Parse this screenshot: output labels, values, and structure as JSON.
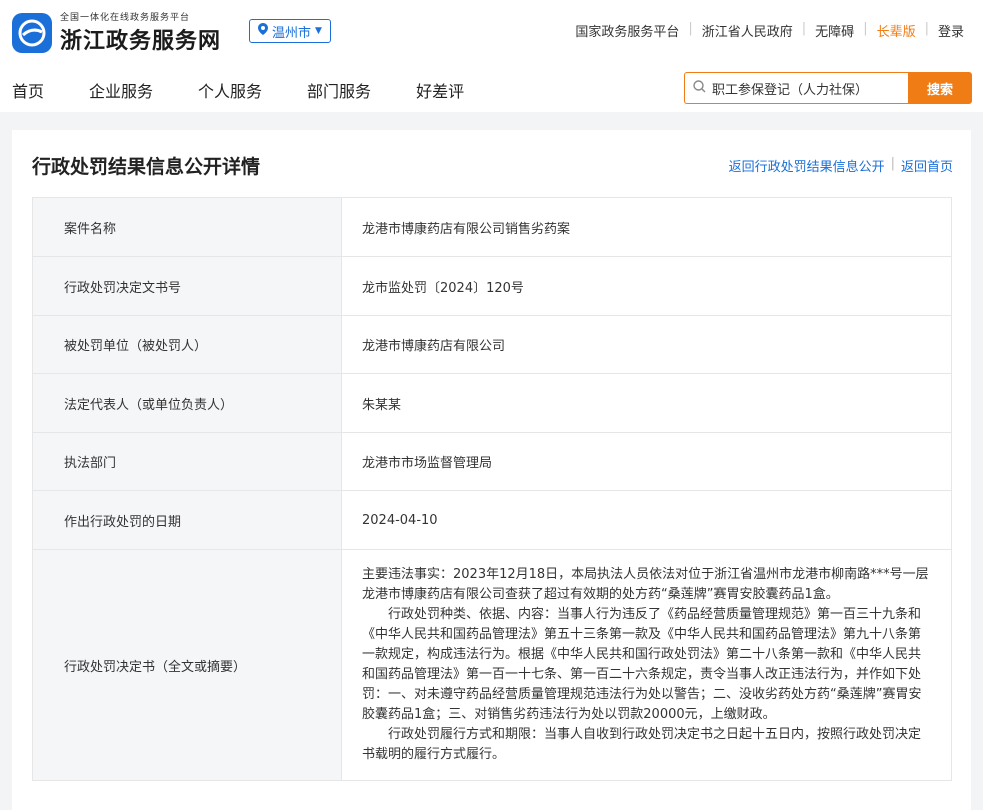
{
  "header": {
    "logo_subtitle": "全国一体化在线政务服务平台",
    "logo_title": "浙江政务服务网",
    "city": "温州市",
    "top_links": [
      "国家政务服务平台",
      "浙江省人民政府",
      "无障碍"
    ],
    "elder_mode": "长辈版",
    "login": "登录",
    "nav": [
      "首页",
      "企业服务",
      "个人服务",
      "部门服务",
      "好差评"
    ],
    "search_placeholder": "职工参保登记（人力社保）",
    "search_button": "搜索"
  },
  "page": {
    "title": "行政处罚结果信息公开详情",
    "back_list": "返回行政处罚结果信息公开",
    "back_home": "返回首页"
  },
  "rows": [
    {
      "label": "案件名称",
      "value": "龙港市博康药店有限公司销售劣药案"
    },
    {
      "label": "行政处罚决定文书号",
      "value": "龙市监处罚〔2024〕120号"
    },
    {
      "label": "被处罚单位（被处罚人）",
      "value": "龙港市博康药店有限公司"
    },
    {
      "label": "法定代表人（或单位负责人）",
      "value": "朱某某"
    },
    {
      "label": "执法部门",
      "value": "龙港市市场监督管理局"
    },
    {
      "label": "作出行政处罚的日期",
      "value": "2024-04-10"
    }
  ],
  "decision": {
    "label": "行政处罚决定书（全文或摘要）",
    "p1": "主要违法事实：2023年12月18日，本局执法人员依法对位于浙江省温州市龙港市柳南路***号一层龙港市博康药店有限公司查获了超过有效期的处方药“桑莲牌”赛胃安胶囊药品1盒。",
    "p2": "行政处罚种类、依据、内容：当事人行为违反了《药品经营质量管理规范》第一百三十九条和《中华人民共和国药品管理法》第五十三条第一款及《中华人民共和国药品管理法》第九十八条第一款规定，构成违法行为。根据《中华人民共和国行政处罚法》第二十八条第一款和《中华人民共和国药品管理法》第一百一十七条、第一百二十六条规定，责令当事人改正违法行为，并作如下处罚：一、对未遵守药品经营质量管理规范违法行为处以警告；二、没收劣药处方药“桑莲牌”赛胃安胶囊药品1盒；三、对销售劣药违法行为处以罚款20000元，上缴财政。",
    "p3": "行政处罚履行方式和期限：当事人自收到行政处罚决定书之日起十五日内，按照行政处罚决定书载明的履行方式履行。"
  }
}
